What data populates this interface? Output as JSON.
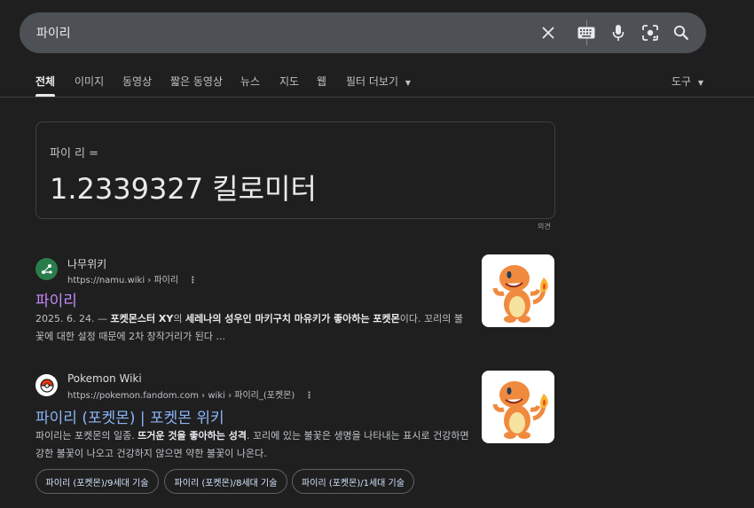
{
  "search": {
    "query": "파이리"
  },
  "tabs": [
    {
      "label": "전체"
    },
    {
      "label": "이미지"
    },
    {
      "label": "동영상"
    },
    {
      "label": "짧은 동영상"
    },
    {
      "label": "뉴스"
    },
    {
      "label": "지도"
    },
    {
      "label": "웹"
    },
    {
      "label": "필터 더보기"
    }
  ],
  "tools_label": "도구",
  "converter": {
    "label": "파이 리 =",
    "value": "1.2339327 킬로미터",
    "feedback": "의견"
  },
  "results": [
    {
      "site": "나무위키",
      "url": "https://namu.wiki › 파이리",
      "title": "파이리",
      "date": "2025. 6. 24. — ",
      "snippet_b1": "포켓몬스터 XY",
      "snippet_t1": "의 ",
      "snippet_b2": "세레나의 성우인 마키구치 마유키가 좋아하는 포켓몬",
      "snippet_t2": "이다. 꼬리의 불꽃에 대한 설정 때문에 2차 창작거리가 된다 ..."
    },
    {
      "site": "Pokemon Wiki",
      "url": "https://pokemon.fandom.com › wiki › 파이리_(포켓몬)",
      "title": "파이리 (포켓몬) | 포켓몬 위키",
      "snippet_t0": "파이리는 포켓몬의 일종. ",
      "snippet_b1": "뜨거운 것을 좋아하는 성격",
      "snippet_t2": ". 꼬리에 있는 불꽃은 생명을 나타내는 표시로 건강하면 강한 불꽃이 나오고 건강하지 않으면 약한 불꽃이 나온다."
    }
  ],
  "chips": [
    {
      "label": "파이리 (포켓몬)/9세대 기술"
    },
    {
      "label": "파이리 (포켓몬)/8세대 기술"
    },
    {
      "label": "파이리 (포켓몬)/1세대 기술"
    }
  ],
  "colors": {
    "background": "#1f1f1f",
    "searchbar": "#4d5156",
    "visited_link": "#c58af9",
    "link": "#8ab4f8"
  },
  "icons": [
    "close-icon",
    "keyboard-icon",
    "mic-icon",
    "lens-icon",
    "search-icon",
    "namu-logo-icon",
    "pokeball-icon",
    "more-vert-icon"
  ]
}
